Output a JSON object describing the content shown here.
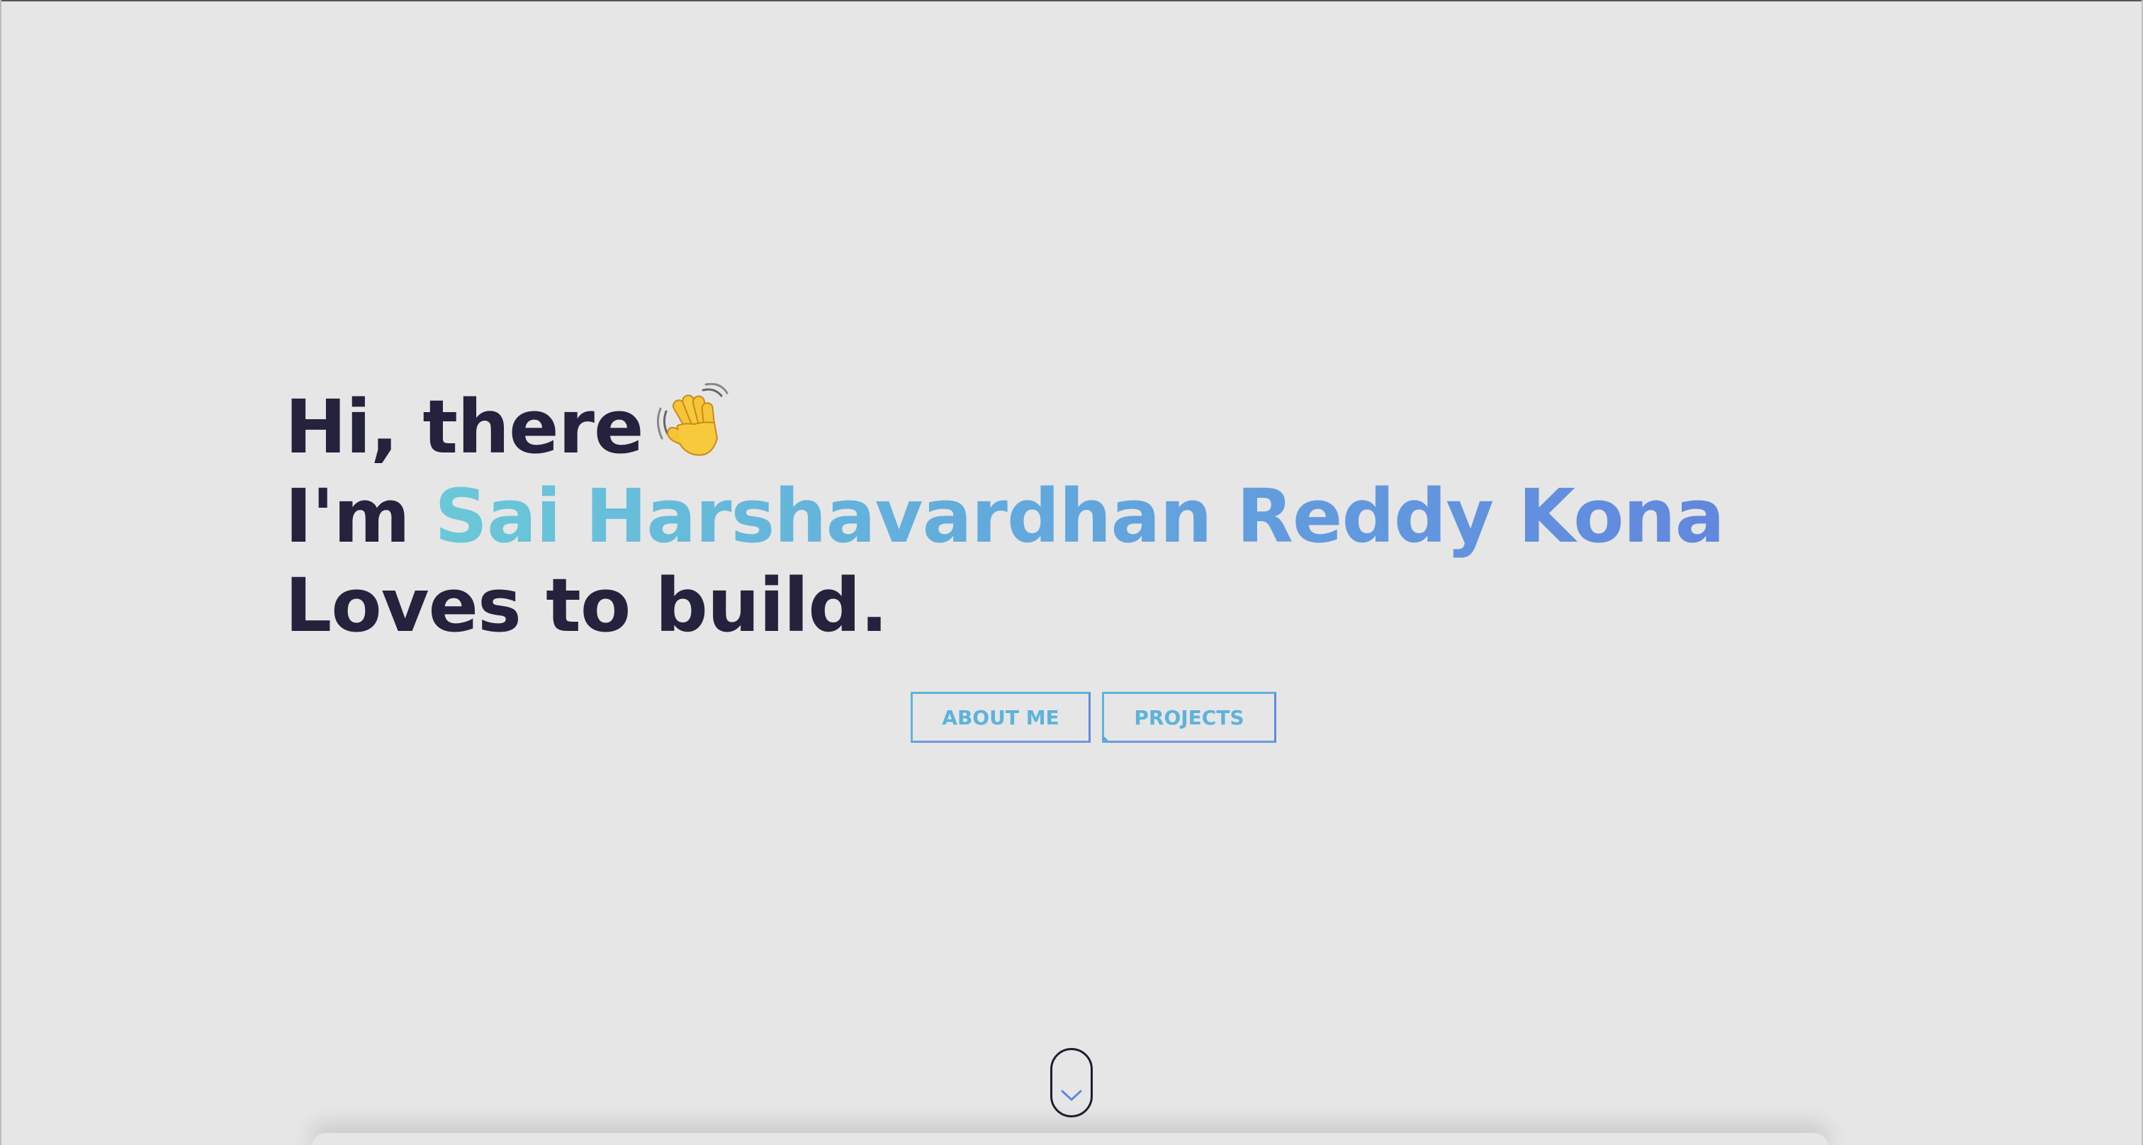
{
  "hero": {
    "greeting": "Hi, there",
    "wave_icon": "waving-hand-icon",
    "intro_prefix": "I'm ",
    "name": "Sai Harshavardhan Reddy Kona",
    "tagline": "Loves to build."
  },
  "buttons": {
    "about_label": "ABOUT ME",
    "projects_label": "PROJECTS"
  },
  "scroll": {
    "icon": "chevron-down-icon"
  },
  "colors": {
    "background": "#e6e6e6",
    "heading": "#24223c",
    "gradient_start": "#6ac8d8",
    "gradient_end": "#6287de",
    "button_text": "#5eb2dd"
  }
}
